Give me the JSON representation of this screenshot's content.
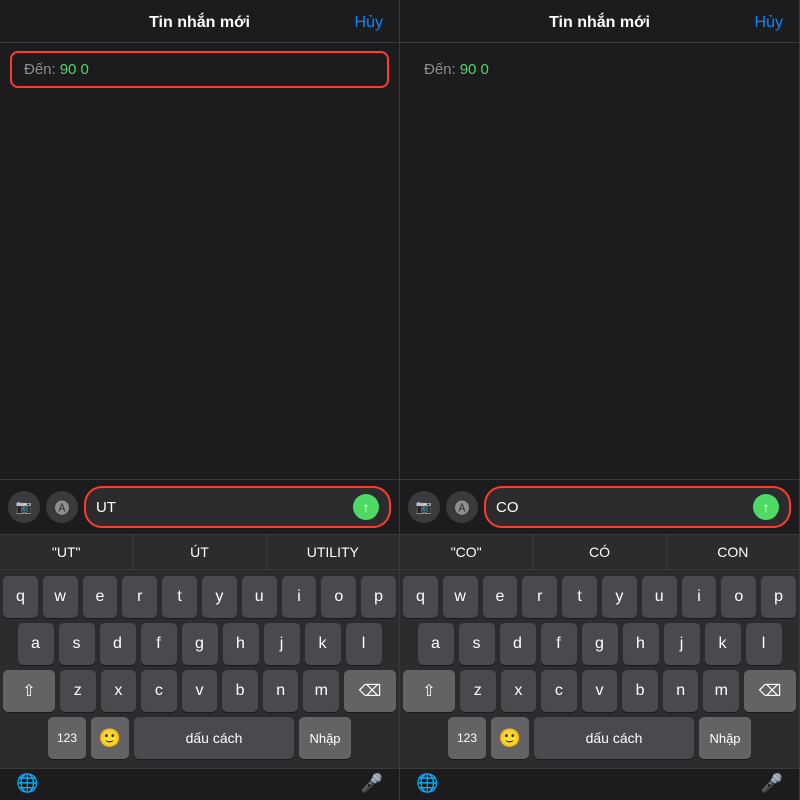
{
  "panels": [
    {
      "id": "left",
      "header": {
        "title": "Tin nhắn mới",
        "cancel_label": "Hủy"
      },
      "to_field": {
        "label": "Đến:",
        "value": "90 0"
      },
      "input": {
        "text": "UT",
        "send_label": "↑"
      },
      "autocomplete": [
        {
          "label": "\"UT\"",
          "type": "quoted"
        },
        {
          "label": "ÚT",
          "type": "plain"
        },
        {
          "label": "UTILITY",
          "type": "plain"
        }
      ],
      "keyboard": {
        "rows": [
          [
            "q",
            "w",
            "e",
            "r",
            "t",
            "y",
            "u",
            "i",
            "o",
            "p"
          ],
          [
            "a",
            "s",
            "d",
            "f",
            "g",
            "h",
            "j",
            "k",
            "l"
          ],
          [
            "shift",
            "z",
            "x",
            "c",
            "v",
            "b",
            "n",
            "m",
            "delete"
          ],
          [
            "123",
            "emoji",
            "dấu cách",
            "Nhập"
          ]
        ]
      },
      "bottom": {
        "left_icon": "globe",
        "right_icon": "mic"
      }
    },
    {
      "id": "right",
      "header": {
        "title": "Tin nhắn mới",
        "cancel_label": "Hủy"
      },
      "to_field": {
        "label": "Đến:",
        "value": "90 0"
      },
      "input": {
        "text": "CO",
        "send_label": "↑"
      },
      "autocomplete": [
        {
          "label": "\"CO\"",
          "type": "quoted"
        },
        {
          "label": "CÓ",
          "type": "plain"
        },
        {
          "label": "CON",
          "type": "plain"
        }
      ],
      "keyboard": {
        "rows": [
          [
            "q",
            "w",
            "e",
            "r",
            "t",
            "y",
            "u",
            "i",
            "o",
            "p"
          ],
          [
            "a",
            "s",
            "d",
            "f",
            "g",
            "h",
            "j",
            "k",
            "l"
          ],
          [
            "shift",
            "z",
            "x",
            "c",
            "v",
            "b",
            "n",
            "m",
            "delete"
          ],
          [
            "123",
            "emoji",
            "dấu cách",
            "Nhập"
          ]
        ]
      },
      "bottom": {
        "left_icon": "globe",
        "right_icon": "mic"
      }
    }
  ]
}
